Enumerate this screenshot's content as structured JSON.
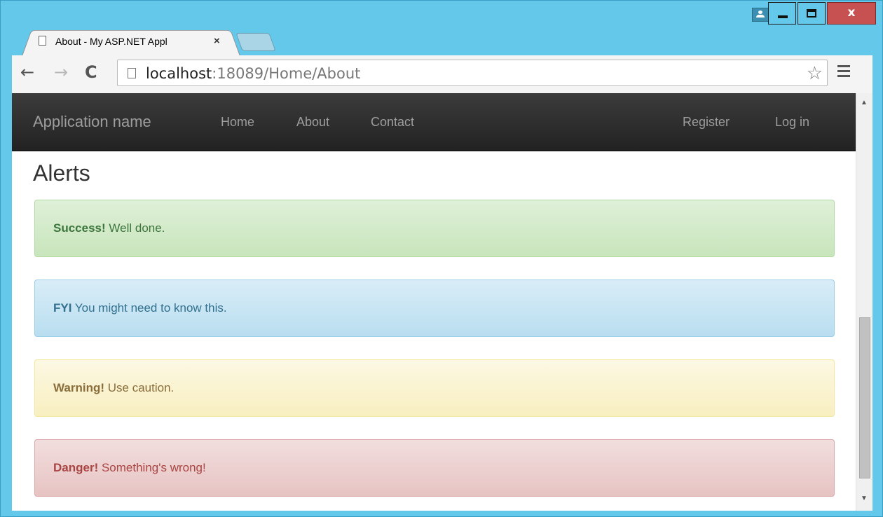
{
  "browser": {
    "tab_title": "About - My ASP.NET Appl",
    "tab_close": "×",
    "url_host": "localhost",
    "url_path": ":18089/Home/About"
  },
  "window_controls": {
    "close": "x"
  },
  "navbar": {
    "brand": "Application name",
    "links": [
      "Home",
      "About",
      "Contact"
    ],
    "right_links": [
      "Register",
      "Log in"
    ]
  },
  "page": {
    "title": "Alerts",
    "alerts": [
      {
        "strong": "Success!",
        "text": " Well done.",
        "kind": "success"
      },
      {
        "strong": "FYI",
        "text": " You might need to know this.",
        "kind": "info"
      },
      {
        "strong": "Warning!",
        "text": " Use caution.",
        "kind": "warning"
      },
      {
        "strong": "Danger!",
        "text": " Something's wrong!",
        "kind": "danger"
      }
    ]
  },
  "colors": {
    "window_frame": "#64c8eb",
    "navbar_bg": "#222222",
    "success": "#3c763d",
    "info": "#31708f",
    "warning": "#8a6d3b",
    "danger": "#a94442"
  }
}
